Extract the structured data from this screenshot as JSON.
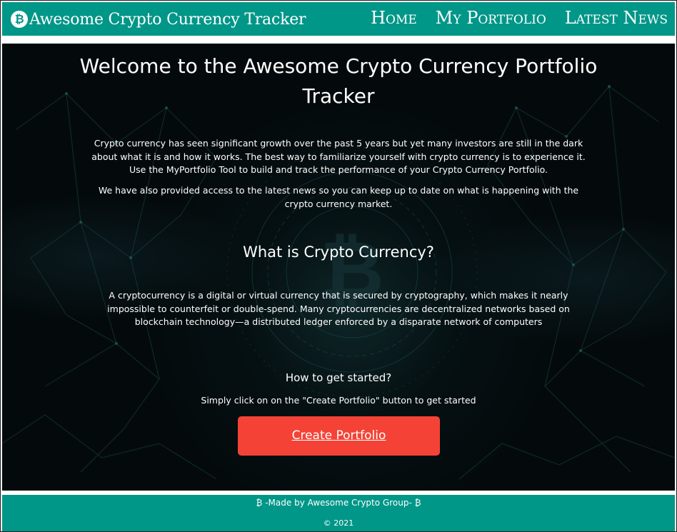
{
  "header": {
    "brand_icon": "bitcoin-icon",
    "brand_glyph": "₿",
    "brand_title": "Awesome Crypto Currency Tracker",
    "nav": {
      "home": "Home",
      "portfolio": "My Portfolio",
      "news": "Latest News"
    }
  },
  "hero": {
    "title": "Welcome to the Awesome Crypto Currency Portfolio Tracker",
    "intro": "Crypto currency has seen significant growth over the past 5 years but yet many investors are still in the dark about what it is and how it works. The best way to familiarize yourself with crypto currency is to experience it. Use the MyPortfolio Tool to build and track the performance of your Crypto Currency Portfolio.",
    "news_note": "We have also provided access to the latest news so you can keep up to date on what is happening with the crypto currency market.",
    "what_is_heading": "What is Crypto Currency?",
    "definition": "A cryptocurrency is a digital or virtual currency that is secured by cryptography, which makes it nearly impossible to counterfeit or double-spend. Many cryptocurrencies are decentralized networks based on blockchain technology—a distributed ledger enforced by a disparate network of computers",
    "get_started_heading": "How to get started?",
    "instructions": "Simply click on on the \"Create Portfolio\" button to get started",
    "cta_label": "Create Portfolio"
  },
  "footer": {
    "credit": "₿ -Made by Awesome Crypto Group- ₿",
    "copyright": "© 2021"
  },
  "colors": {
    "brand_teal": "#009688",
    "cta_red": "#f44336",
    "hero_background": "#040a0c",
    "text": "#ffffff"
  }
}
